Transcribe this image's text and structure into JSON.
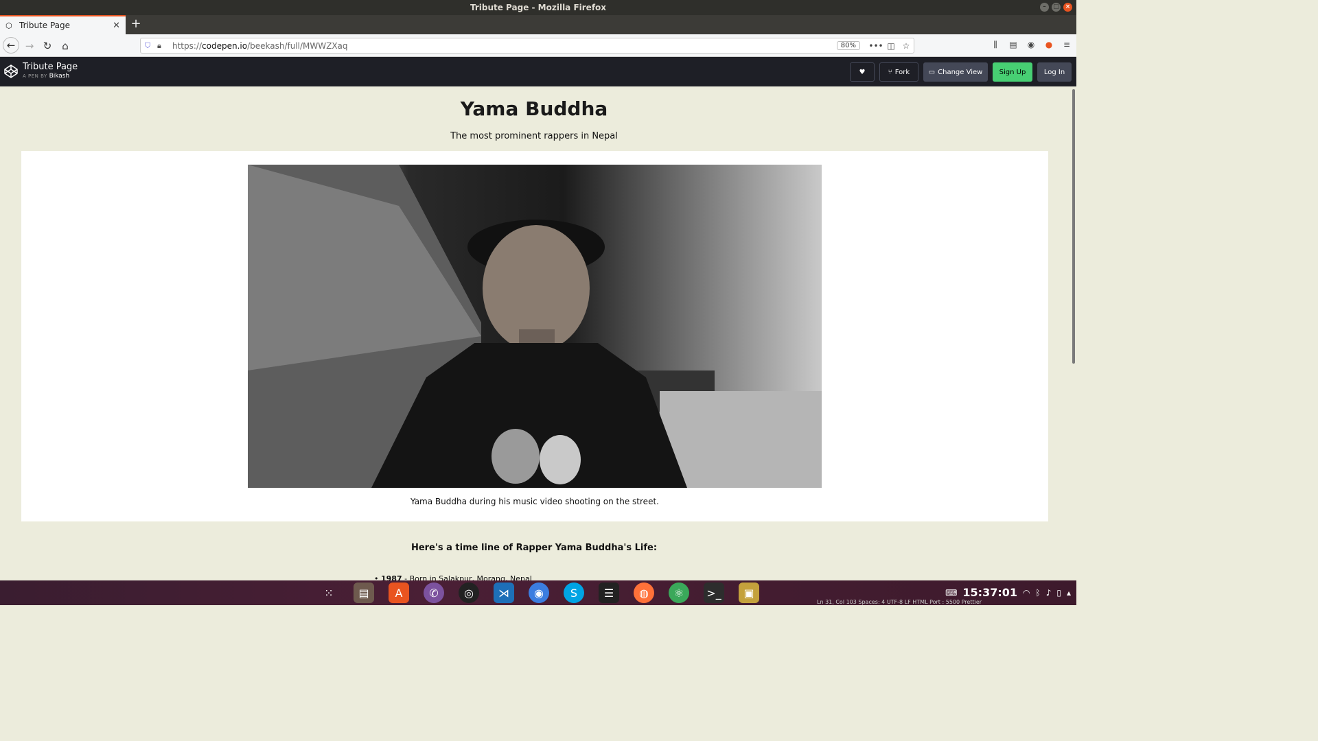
{
  "window": {
    "title": "Tribute Page - Mozilla Firefox"
  },
  "tab": {
    "label": "Tribute Page",
    "new_tab": "+"
  },
  "nav": {
    "url_prefix": "https://",
    "url_domain": "codepen.io",
    "url_path": "/beekash/full/MWWZXaq",
    "zoom": "80%"
  },
  "codepen": {
    "title": "Tribute Page",
    "by_label": "A PEN BY",
    "author": "Bikash",
    "fork_label": "Fork",
    "change_view_label": "Change View",
    "signup_label": "Sign Up",
    "login_label": "Log In"
  },
  "page": {
    "title": "Yama Buddha",
    "subtitle": "The most prominent rappers in Nepal",
    "image_caption": "Yama Buddha during his music video shooting on the street.",
    "timeline_heading": "Here's a time line of Rapper Yama Buddha's Life:",
    "timeline": [
      {
        "year": "1987",
        "text": " - Born in Salakpur, Morang, Nepal"
      }
    ]
  },
  "taskbar": {
    "clock": "15:37:01",
    "status_text": "Ln 31, Col 103   Spaces: 4   UTF-8   LF   HTML   Port : 5500   Prettier"
  }
}
